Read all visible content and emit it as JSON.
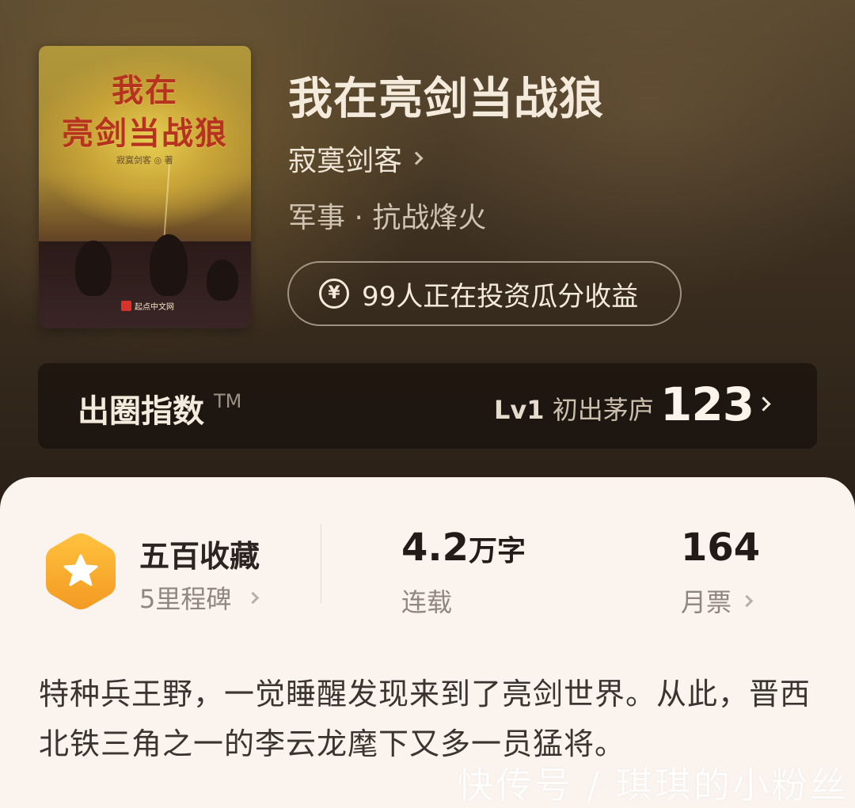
{
  "cover": {
    "title_line1": "我在",
    "title_line2": "亮剑当战狼",
    "author_credit": "寂寞剑客 ◎ 著",
    "publisher": "起点中文网"
  },
  "book": {
    "title": "我在亮剑当战狼",
    "author": "寂寞剑客",
    "genre": "军事 · 抗战烽火",
    "invest_text": "99人正在投资瓜分收益"
  },
  "index_card": {
    "label": "出圈指数",
    "tm": "TM",
    "level_tag": "Lv1",
    "level_name": "初出茅庐",
    "score": "123"
  },
  "stats": {
    "collection_title": "五百收藏",
    "collection_sub": "5里程碑",
    "word_count_number": "4.2",
    "word_count_unit": "万字",
    "status": "连载",
    "monthly_votes": "164",
    "monthly_votes_label": "月票"
  },
  "synopsis": "特种兵王野，一觉睡醒发现来到了亮剑世界。从此，晋西北铁三角之一的李云龙麾下又多一员猛将。",
  "watermark": "快传号 / 琪琪的小粉丝",
  "colors": {
    "hero_bg": "#3d3021",
    "panel_bg": "#fbf3ed",
    "badge_orange": "#f7a531"
  }
}
